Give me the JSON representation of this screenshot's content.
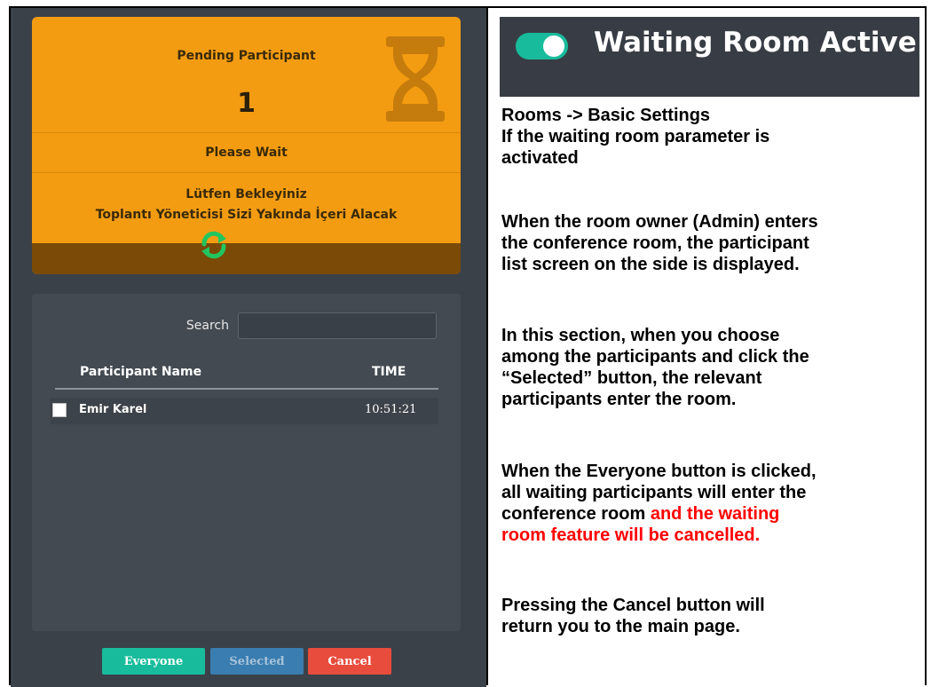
{
  "pending": {
    "title": "Pending Participant",
    "count": "1",
    "please_wait": "Please Wait",
    "turkish_line1": "Lütfen Bekleyiniz",
    "turkish_line2": "Toplantı Yöneticisi Sizi Yakında İçeri Alacak",
    "icons": [
      "hourglass-icon",
      "refresh-icon"
    ]
  },
  "list": {
    "search_label": "Search",
    "search_value": "",
    "col_name": "Participant Name",
    "col_time": "TIME",
    "rows": [
      {
        "name": "Emir Karel",
        "time": "10:51:21",
        "checked": false
      }
    ]
  },
  "buttons": {
    "everyone": "Everyone",
    "selected": "Selected",
    "cancel": "Cancel"
  },
  "banner": {
    "label": "Waiting Room Active",
    "toggle_on": true
  },
  "description": {
    "p1_line1": "Rooms -> Basic Settings",
    "p1_line2": "If the waiting room parameter is",
    "p1_line3": "activated",
    "p2_line1": "When the room owner (Admin) enters",
    "p2_line2": "the conference room, the participant",
    "p2_line3": "list screen on the side is displayed.",
    "p3_line1": "In this section, when you choose",
    "p3_line2": "among the participants and click the",
    "p3_line3": "“Selected” button, the relevant",
    "p3_line4": "participants enter the room.",
    "p4_line1": "When the Everyone button is clicked,",
    "p4_line2": "all waiting participants will enter the",
    "p4_line3_black": "conference room ",
    "p4_line3_red": "and the waiting",
    "p4_line4_red": "room feature will be cancelled.",
    "p5_line1": "Pressing the Cancel button will",
    "p5_line2": "return you to the main page."
  },
  "colors": {
    "pending_bg": "#f39c12",
    "panel_bg": "#434a52",
    "everyone": "#18bc9c",
    "selected": "#3a7db0",
    "cancel": "#e74c3c",
    "highlight": "#ff0000"
  }
}
